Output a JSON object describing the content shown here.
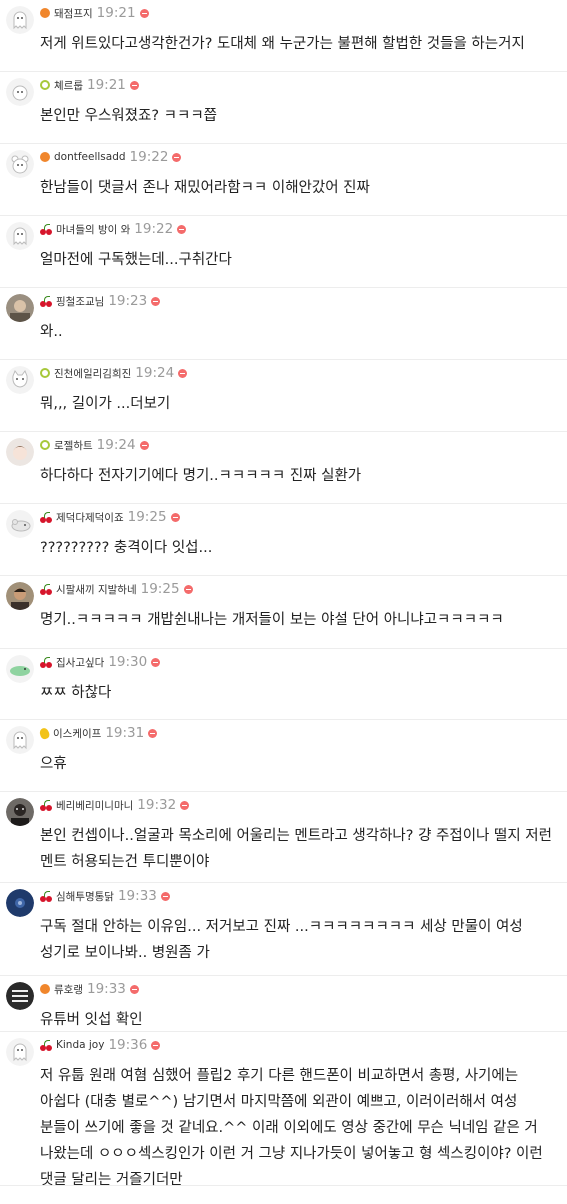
{
  "comments": [
    {
      "nick": "돼점프지",
      "time": "19:21",
      "level": "orange",
      "avatar": "ghost",
      "text": "저게 위트있다고생각한건가? 도대체 왜 누군가는 불편해 할법한 것들을 하는거지"
    },
    {
      "nick": "쳬르룹",
      "time": "19:21",
      "level": "green",
      "avatar": "sheep",
      "text": "본인만 우스워졌죠? ㅋㅋㅋ쯥"
    },
    {
      "nick": "dontfeellsadd",
      "time": "19:22",
      "level": "orange",
      "avatar": "bear",
      "text": "한남들이 댓글서 존나 재밌어라함ㅋㅋ 이해안갔어 진짜"
    },
    {
      "nick": "마녀들의 방이 와",
      "time": "19:22",
      "level": "cherry",
      "avatar": "ghost",
      "text": "얼마전에 구독했는데...구취간다"
    },
    {
      "nick": "핑철조교님",
      "time": "19:23",
      "level": "cherry",
      "avatar": "photo-face",
      "text": "와.."
    },
    {
      "nick": "진천에일리김희진",
      "time": "19:24",
      "level": "green",
      "avatar": "cat",
      "text": "뭐,,, 길이가 ...더보기"
    },
    {
      "nick": "로젤하트",
      "time": "19:24",
      "level": "green",
      "avatar": "anime",
      "text": "하다하다 전자기기에다 명기..ㅋㅋㅋㅋㅋ 진짜 실환가"
    },
    {
      "nick": "제덕다제덕이죠",
      "time": "19:25",
      "level": "cherry",
      "avatar": "mouse",
      "text": "????????? 충격이다 잇섭..."
    },
    {
      "nick": "시팔새끼 지발하네",
      "time": "19:25",
      "level": "cherry",
      "avatar": "photo-man",
      "text": "명기..ㅋㅋㅋㅋㅋ 개밥쉰내나는 개저들이 보는 야설 단어 아니냐고ㅋㅋㅋㅋㅋ"
    },
    {
      "nick": "집사고싶다",
      "time": "19:30",
      "level": "cherry",
      "avatar": "dino",
      "text": "ㅉㅉ 하찮다"
    },
    {
      "nick": "이스케이프",
      "time": "19:31",
      "level": "yellow",
      "avatar": "ghost",
      "text": "으휴"
    },
    {
      "nick": "베리베리미니마니",
      "time": "19:32",
      "level": "cherry",
      "avatar": "photo-dark",
      "text": "본인 컨셉이나..얼굴과 목소리에 어울리는 멘트라고 생각하나? 걍 주접이나 떨지 저런 멘트 허용되는건 투디뿐이야"
    },
    {
      "nick": "심해투명통닭",
      "time": "19:33",
      "level": "cherry",
      "avatar": "photo-blue",
      "text": "구독 절대 안하는 이유임... 저거보고 진짜 ...ㅋㅋㅋㅋㅋㅋㅋㅋ 세상 만물이 여성 성기로 보이나봐.. 병원좀 가"
    },
    {
      "nick": "류호랭",
      "time": "19:33",
      "level": "orange",
      "avatar": "photo-text",
      "text": "유튜버 잇섭 확인"
    },
    {
      "nick": "Kinda joy",
      "time": "19:36",
      "level": "cherry",
      "avatar": "ghost",
      "text": "저 유툽 원래 여혐 심했어 플립2 후기 다른 핸드폰이 비교하면서 총평, 사기에는 아쉽다 (대충 별로^^) 남기면서 마지막쯤에 외관이 예쁘고, 이러이러해서 여성 분들이 쓰기에 좋을 것 같네요.^^ 이래 이외에도 영상 중간에 무슨 닉네임 같은 거 나왔는데 ㅇㅇㅇ섹스킹인가 이런 거 그냥 지나가듯이 넣어놓고 형 섹스킹이야? 이런 댓글 달리는 거즐기더만"
    }
  ]
}
